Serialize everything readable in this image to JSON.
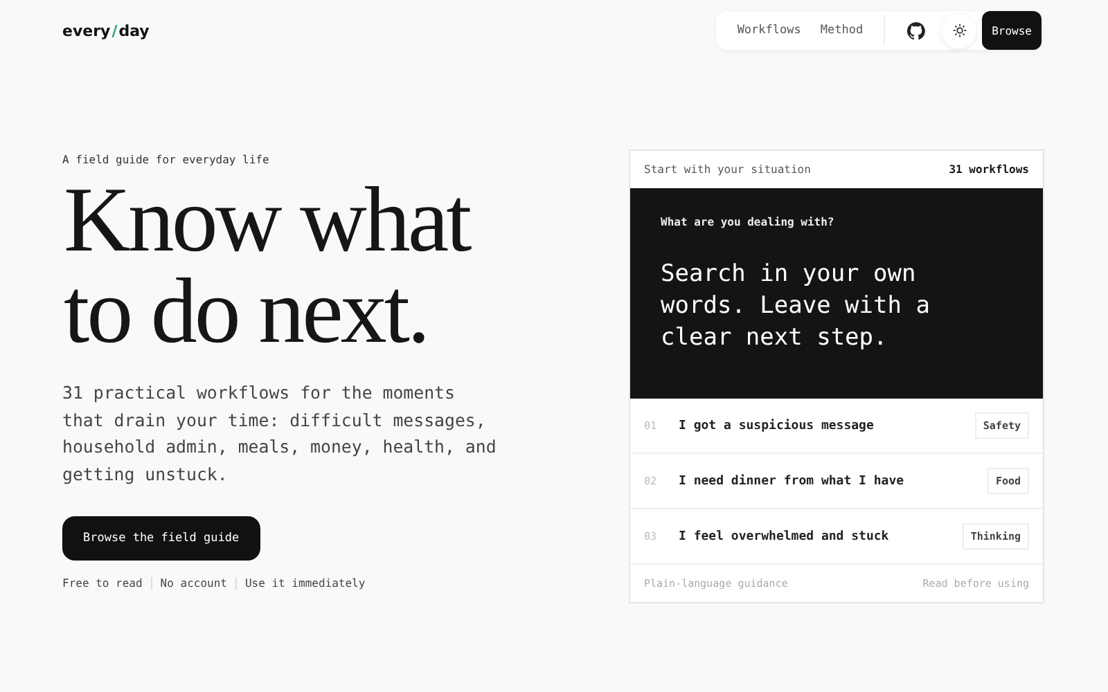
{
  "logo": {
    "left": "every",
    "separator": "/",
    "right": "day"
  },
  "nav": {
    "links": [
      "Workflows",
      "Method"
    ],
    "cta": "Browse"
  },
  "hero": {
    "eyebrow": "A field guide for everyday life",
    "headline": [
      "Know what",
      "to do next."
    ],
    "lede": "31 practical workflows for the moments that drain your time: difficult messages, household admin, meals, money, health, and getting unstuck.",
    "button": "Browse the field guide",
    "notes": [
      "Free to read",
      "No account",
      "Use it immediately"
    ]
  },
  "card": {
    "header_left": "Start with your situation",
    "header_right": "31 workflows",
    "prompt": "What are you dealing with?",
    "statement": "Search in your own words. Leave with a clear next step.",
    "rows": [
      {
        "number": "01",
        "text": "I got a suspicious message",
        "tag": "Safety"
      },
      {
        "number": "02",
        "text": "I need dinner from what I have",
        "tag": "Food"
      },
      {
        "number": "03",
        "text": "I feel overwhelmed and stuck",
        "tag": "Thinking"
      }
    ],
    "footer_left": "Plain-language guidance",
    "footer_right": "Read before using"
  }
}
